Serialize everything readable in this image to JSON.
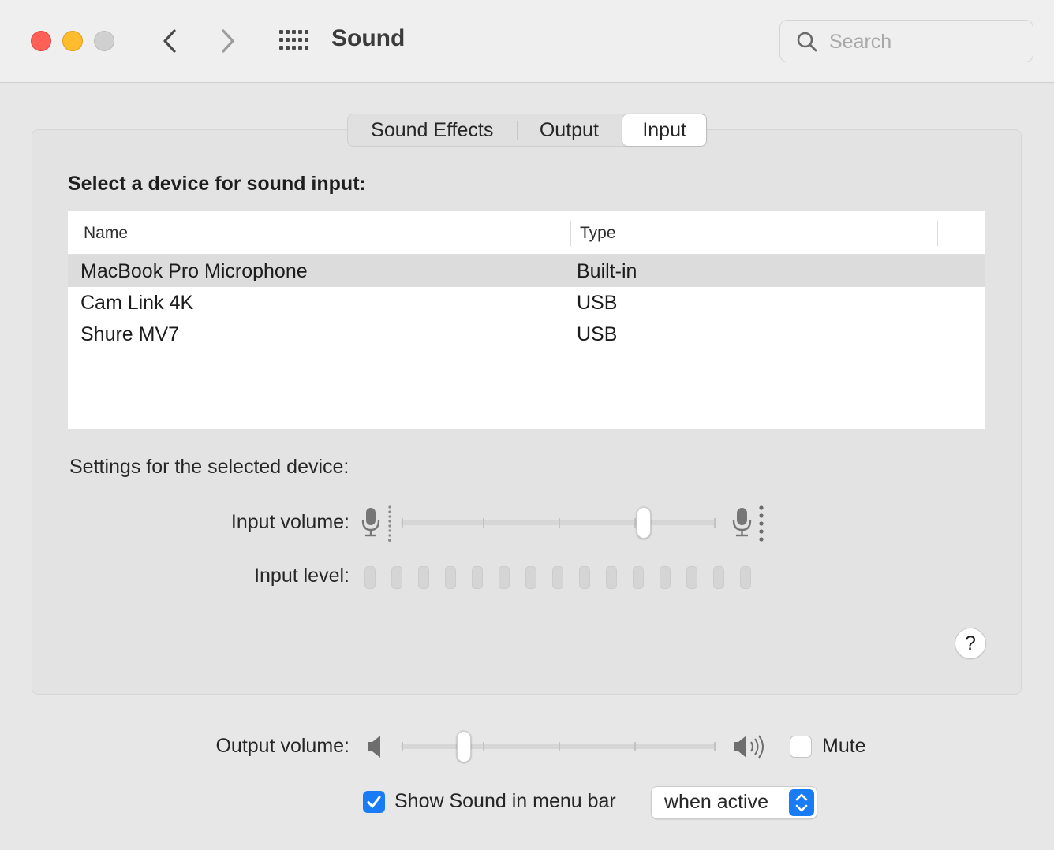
{
  "window": {
    "title": "Sound",
    "search_placeholder": "Search"
  },
  "tabs": [
    {
      "label": "Sound Effects",
      "selected": false
    },
    {
      "label": "Output",
      "selected": false
    },
    {
      "label": "Input",
      "selected": true
    }
  ],
  "input": {
    "section_title": "Select a device for sound input:",
    "columns": {
      "name": "Name",
      "type": "Type"
    },
    "devices": [
      {
        "name": "MacBook Pro Microphone",
        "type": "Built-in",
        "selected": true
      },
      {
        "name": "Cam Link 4K",
        "type": "USB",
        "selected": false
      },
      {
        "name": "Shure MV7",
        "type": "USB",
        "selected": false
      }
    ],
    "settings_title": "Settings for the selected device:",
    "volume_label": "Input volume:",
    "volume_fraction": 0.77,
    "level_label": "Input level:",
    "level_segments": 15,
    "level_active": 0
  },
  "output": {
    "volume_label": "Output volume:",
    "volume_fraction": 0.2,
    "mute_label": "Mute",
    "mute_checked": false
  },
  "menu_bar": {
    "show_label": "Show Sound in menu bar",
    "show_checked": true,
    "popup_value": "when active"
  },
  "colors": {
    "accent": "#1a7cf5",
    "close": "#fe5f57",
    "minimize": "#febc2e",
    "zoom_disabled": "#d0d0d0"
  },
  "icons": {
    "back": "chevron-left-icon",
    "forward": "chevron-right-icon",
    "grid": "grid-icon",
    "search": "search-icon",
    "mic_quiet": "mic-quiet-icon",
    "mic_loud": "mic-loud-icon",
    "speaker_low": "speaker-low-icon",
    "speaker_high": "speaker-high-icon",
    "help": "?"
  }
}
